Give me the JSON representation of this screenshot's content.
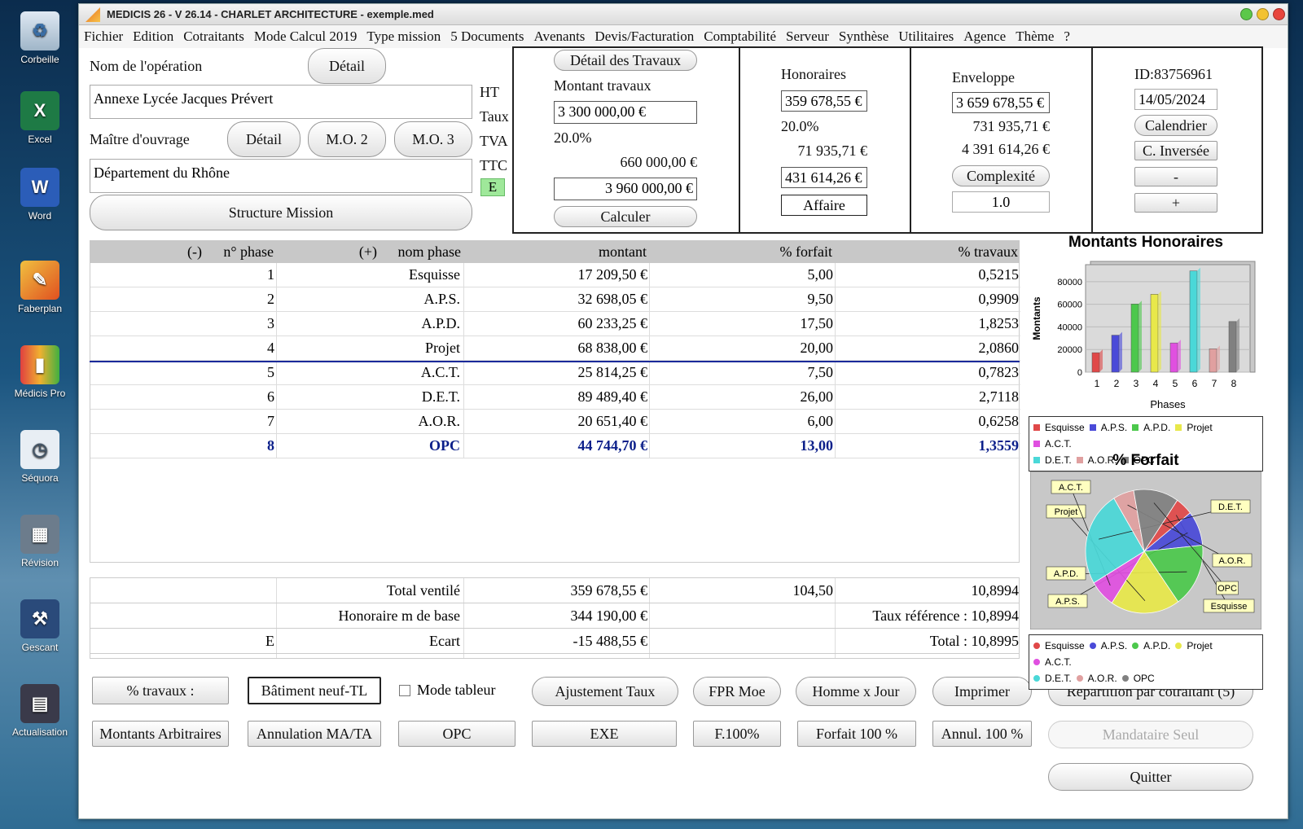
{
  "desktop": {
    "icons": [
      {
        "label": "Corbeille"
      },
      {
        "label": "Excel"
      },
      {
        "label": "Word"
      },
      {
        "label": "Faberplan"
      },
      {
        "label": "Médicis Pro"
      },
      {
        "label": "Séquora"
      },
      {
        "label": "Révision"
      },
      {
        "label": "Gescant"
      },
      {
        "label": "Actualisation"
      }
    ]
  },
  "window": {
    "title": "MEDICIS 26  - V 26.14 - CHARLET ARCHITECTURE - exemple.med"
  },
  "menu": [
    "Fichier",
    "Edition",
    "Cotraitants",
    "Mode Calcul 2019",
    "Type mission",
    "5 Documents",
    "Avenants",
    "Devis/Facturation",
    "Comptabilité",
    "Serveur",
    "Synthèse",
    "Utilitaires",
    "Agence",
    "Thème",
    "?"
  ],
  "operation": {
    "label": "Nom de l'opération",
    "detail_button": "Détail",
    "name": "Annexe Lycée Jacques Prévert",
    "owner_label": "Maître d'ouvrage",
    "owner_detail_button": "Détail",
    "mo2_button": "M.O. 2",
    "mo3_button": "M.O. 3",
    "owner": "Département du Rhône",
    "structure_button": "Structure Mission"
  },
  "travaux": {
    "labels": {
      "ht": "HT",
      "taux": "Taux",
      "tva": "TVA",
      "ttc": "TTC"
    },
    "e_badge": "E",
    "detail_button": "Détail des Travaux",
    "montant_label": "Montant travaux",
    "montant": "3 300 000,00 €",
    "taux": "20.0%",
    "tva": "660 000,00 €",
    "ttc": "3 960 000,00 €",
    "calc_button": "Calculer"
  },
  "honoraires": {
    "label": "Honoraires",
    "ht": "359 678,55 €",
    "taux": "20.0%",
    "tva": "71 935,71 €",
    "ttc": "431 614,26 €",
    "affaire_button": "Affaire"
  },
  "enveloppe": {
    "label": "Enveloppe",
    "ht": "3 659 678,55 €",
    "tva": "731 935,71 €",
    "ttc": "4 391 614,26 €",
    "complexite_button": "Complexité",
    "complexite": "1.0"
  },
  "idpanel": {
    "id": "ID:83756961",
    "date": "14/05/2024",
    "calendar_button": "Calendrier",
    "inverse_button": "C. Inversée",
    "minus_button": "-",
    "plus_button": "+"
  },
  "table": {
    "headers": {
      "minus": "(-)",
      "phase": "n° phase",
      "plus": "(+)",
      "name": "nom phase",
      "montant": "montant",
      "forfait": "% forfait",
      "travaux": "% travaux"
    },
    "rows": [
      {
        "n": "1",
        "name": "Esquisse",
        "montant": "17 209,50 €",
        "forfait": "5,00",
        "travaux": "0,5215"
      },
      {
        "n": "2",
        "name": "A.P.S.",
        "montant": "32 698,05 €",
        "forfait": "9,50",
        "travaux": "0,9909"
      },
      {
        "n": "3",
        "name": "A.P.D.",
        "montant": "60 233,25 €",
        "forfait": "17,50",
        "travaux": "1,8253"
      },
      {
        "n": "4",
        "name": "Projet",
        "montant": "68 838,00 €",
        "forfait": "20,00",
        "travaux": "2,0860"
      },
      {
        "n": "5",
        "name": "A.C.T.",
        "montant": "25 814,25 €",
        "forfait": "7,50",
        "travaux": "0,7823"
      },
      {
        "n": "6",
        "name": "D.E.T.",
        "montant": "89 489,40 €",
        "forfait": "26,00",
        "travaux": "2,7118"
      },
      {
        "n": "7",
        "name": "A.O.R.",
        "montant": "20 651,40 €",
        "forfait": "6,00",
        "travaux": "0,6258"
      },
      {
        "n": "8",
        "name": "OPC",
        "montant": "44 744,70 €",
        "forfait": "13,00",
        "travaux": "1,3559"
      }
    ]
  },
  "totals": {
    "ventile_label": "Total ventilé",
    "ventile_montant": "359 678,55 €",
    "ventile_forfait": "104,50",
    "ventile_travaux": "10,8994",
    "base_label": "Honoraire m de base",
    "base_montant": "344 190,00 €",
    "taux_ref": "Taux référence : 10,8994",
    "e_marker": "E",
    "ecart_label": "Ecart",
    "ecart_montant": "-15 488,55 €",
    "total": "Total : 10,8995"
  },
  "buttons": {
    "pct_travaux": "% travaux :",
    "batiment": "Bâtiment neuf-TL",
    "mode_tableur": "Mode tableur",
    "ajustement": "Ajustement Taux",
    "fpr": "FPR Moe",
    "homme_jour": "Homme x Jour",
    "imprimer": "Imprimer",
    "repartition": "Répartition par cotraitant (5)",
    "montants_arb": "Montants Arbitraires",
    "annulation": "Annulation MA/TA",
    "opc": "OPC",
    "exe": "EXE",
    "f100": "F.100%",
    "forfait100": "Forfait 100 %",
    "annul100": "Annul. 100 %",
    "mandataire": "Mandataire Seul",
    "quitter": "Quitter"
  },
  "colors": {
    "Esquisse": "#e04848",
    "A.P.S.": "#4a4ad8",
    "A.P.D.": "#4cc84c",
    "Projet": "#e8e84a",
    "A.C.T.": "#e050e0",
    "D.E.T.": "#4ad8d8",
    "A.O.R.": "#e0a0a0",
    "OPC": "#808080"
  },
  "chart_data": [
    {
      "type": "bar",
      "title": "Montants Honoraires",
      "xlabel": "Phases",
      "ylabel": "Montants",
      "categories": [
        "1",
        "2",
        "3",
        "4",
        "5",
        "6",
        "7",
        "8"
      ],
      "values": [
        17209.5,
        32698.05,
        60233.25,
        68838.0,
        25814.25,
        89489.4,
        20651.4,
        44744.7
      ],
      "yticks": [
        "0",
        "20000",
        "40000",
        "60000",
        "80000"
      ],
      "ylim": [
        0,
        95000
      ],
      "legend": [
        "Esquisse",
        "A.P.S.",
        "A.P.D.",
        "Projet",
        "A.C.T.",
        "D.E.T.",
        "A.O.R.",
        "OPC"
      ]
    },
    {
      "type": "pie",
      "title": "% Forfait",
      "labels": [
        "Esquisse",
        "A.P.S.",
        "A.P.D.",
        "Projet",
        "A.C.T.",
        "D.E.T.",
        "A.O.R.",
        "OPC"
      ],
      "values": [
        5.0,
        9.5,
        17.5,
        20.0,
        7.5,
        26.0,
        6.0,
        13.0
      ],
      "legend": [
        "Esquisse",
        "A.P.S.",
        "A.P.D.",
        "Projet",
        "A.C.T.",
        "D.E.T.",
        "A.O.R.",
        "OPC"
      ]
    }
  ]
}
